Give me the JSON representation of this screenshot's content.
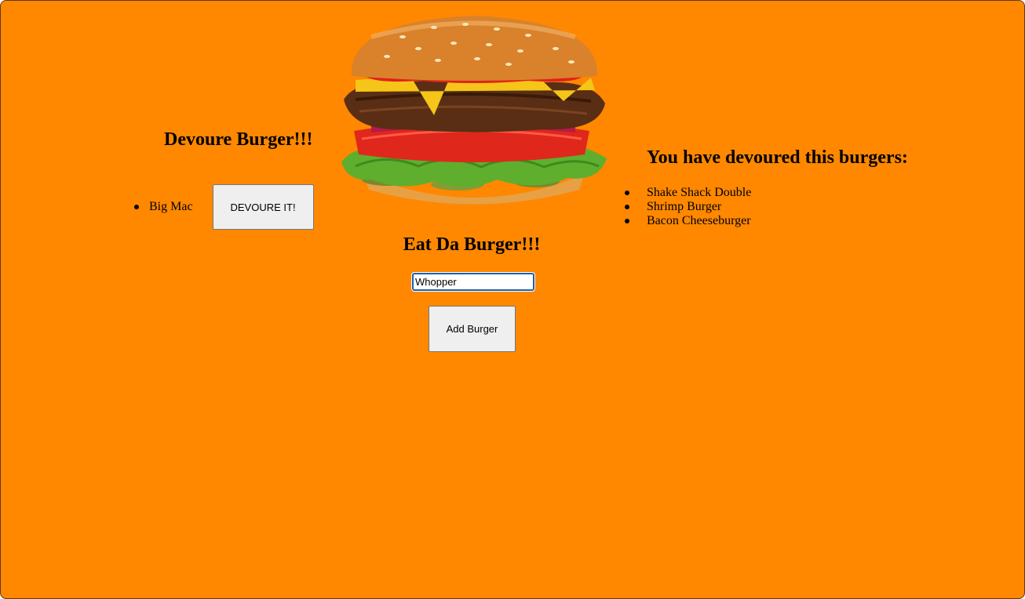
{
  "left": {
    "title": "Devoure Burger!!!",
    "burgers": [
      {
        "name": "Big Mac",
        "button_label": "DEVOURE IT!"
      }
    ]
  },
  "center": {
    "image_icon": "burger-image",
    "title": "Eat Da Burger!!!",
    "input_value": "Whopper",
    "add_button_label": "Add Burger"
  },
  "right": {
    "title": "You have devoured this burgers:",
    "devoured": [
      "Shake Shack Double",
      "Shrimp Burger",
      "Bacon Cheeseburger"
    ]
  },
  "colors": {
    "background": "#ff8800",
    "input_focus": "#1a5fb4"
  }
}
